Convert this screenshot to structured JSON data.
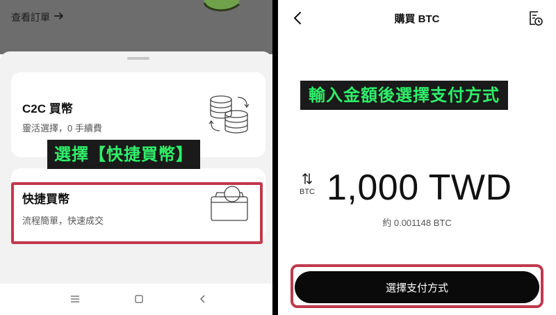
{
  "colors": {
    "accent_green": "#2ef06a",
    "highlight_red": "#c0394d",
    "button_black": "#0a0a0a",
    "sheet_gray": "#f2f2f2"
  },
  "left_screen": {
    "order_link": {
      "label": "查看訂單",
      "icon": "arrow-right-icon"
    },
    "bottom_sheet": {
      "options": [
        {
          "title": "C2C 買幣",
          "subtitle": "靈活選擇，0 手續費",
          "icon": "coins-exchange-icon"
        },
        {
          "title": "快捷買幣",
          "subtitle": "流程簡單，快速成交",
          "icon": "wallet-coin-icon"
        }
      ]
    },
    "annotation": "選擇【快捷買幣】",
    "navbar": {
      "icons": [
        "menu-icon",
        "home-square-icon",
        "back-chevron-icon"
      ]
    }
  },
  "right_screen": {
    "header": {
      "title": "購買 BTC",
      "left_icon": "back-chevron-icon",
      "right_icon": "order-history-icon"
    },
    "annotation": "輸入金額後選擇支付方式",
    "swap": {
      "icon": "swap-arrows-icon",
      "label": "BTC"
    },
    "amount_display": "1,000 TWD",
    "approx_value": "約 0.001148 BTC",
    "primary_button": "選擇支付方式"
  }
}
